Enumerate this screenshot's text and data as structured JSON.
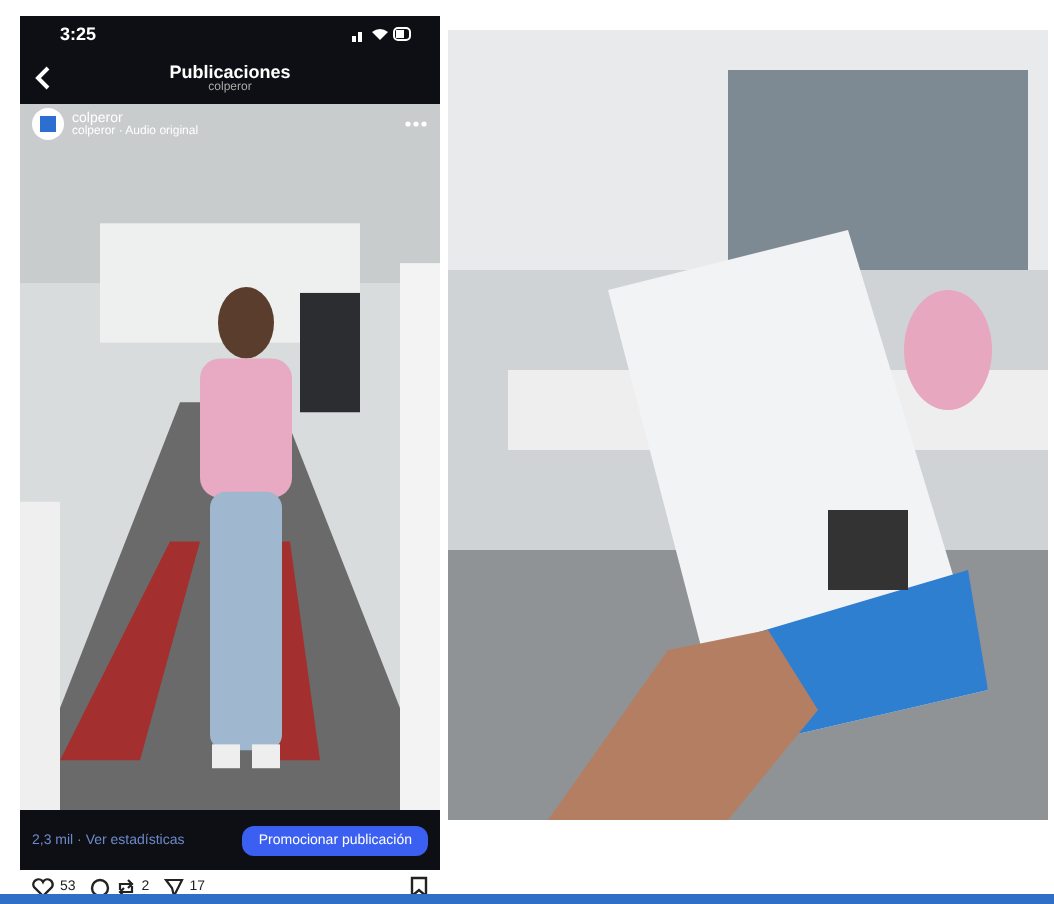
{
  "status_bar": {
    "time": "3:25"
  },
  "header": {
    "title": "Publicaciones",
    "subtitle": "colperor"
  },
  "post": {
    "account": "colperor",
    "audio": "colperor · Audio original"
  },
  "insights": {
    "views": "2,3 mil · Ver estadísticas",
    "button": "Promocionar publicación"
  },
  "actions": [
    {
      "kind": "like",
      "count": "53"
    },
    {
      "kind": "comment"
    },
    {
      "kind": "repost",
      "count": "2"
    },
    {
      "kind": "share",
      "count": "17"
    }
  ]
}
